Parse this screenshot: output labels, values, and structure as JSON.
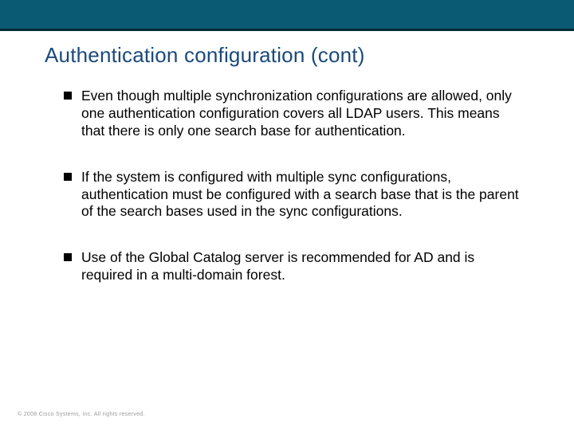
{
  "title": "Authentication configuration (cont)",
  "bullets": [
    "Even though multiple synchronization configurations are allowed, only one authentication configuration covers all LDAP users. This means that there is only one search base for authentication.",
    "If the system is configured with multiple sync configurations, authentication must be configured with a  search base that is the parent of the search bases used in the sync configurations.",
    "Use of the Global Catalog server is recommended for AD and is required in a multi-domain forest."
  ],
  "footer": "© 2008 Cisco Systems, Inc. All rights reserved."
}
